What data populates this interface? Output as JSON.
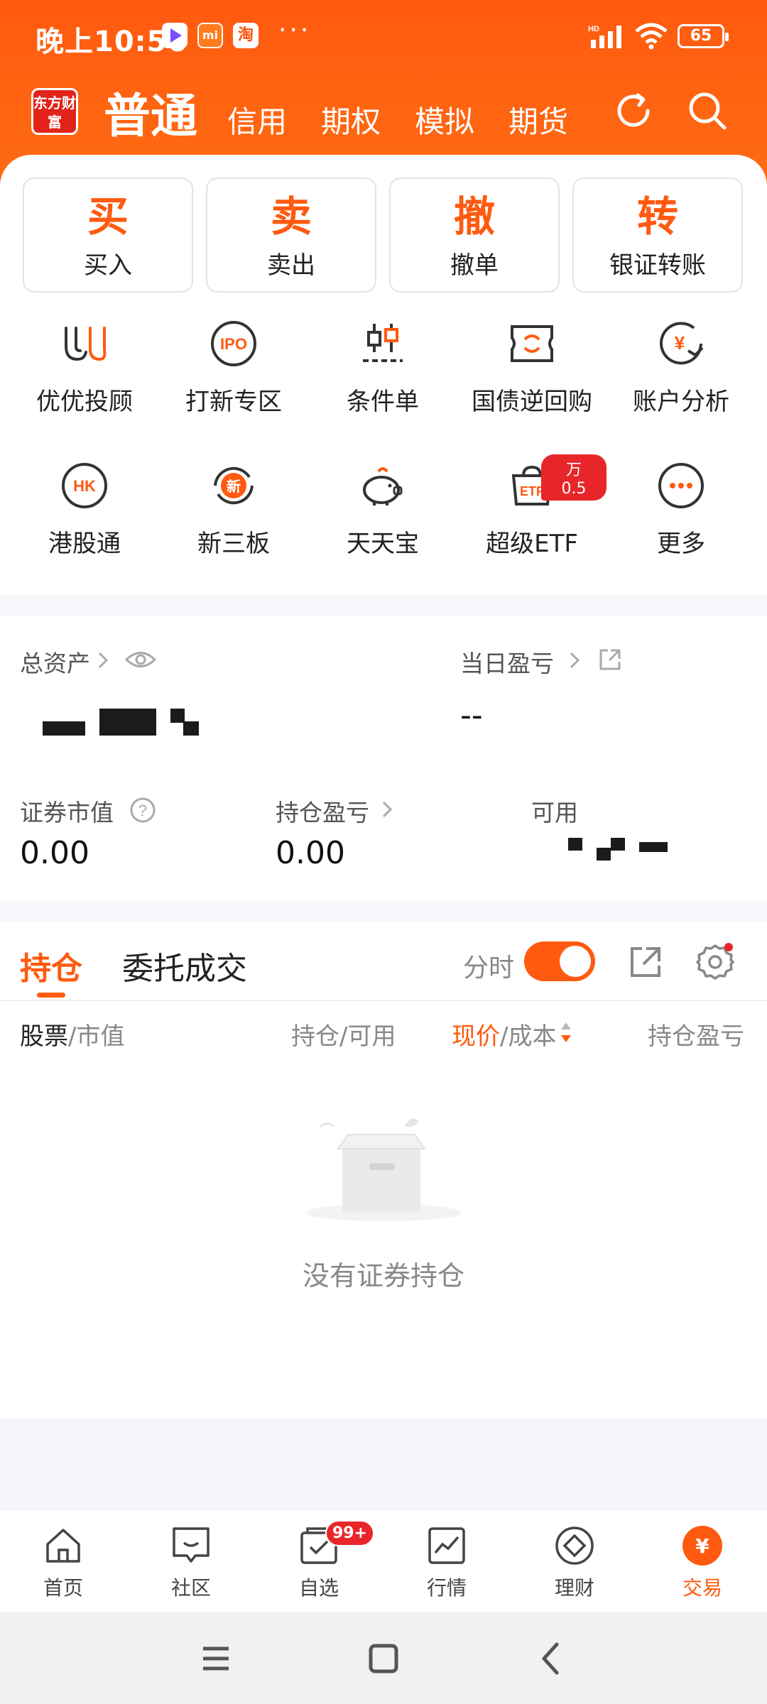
{
  "status": {
    "time": "晚上10:56",
    "more": "···",
    "battery": "65",
    "network": "HD"
  },
  "nav": {
    "logo_text": "东方财富",
    "tabs": [
      "普通",
      "信用",
      "期权",
      "模拟",
      "期货"
    ],
    "active_tab": "普通"
  },
  "actions": [
    {
      "big": "买",
      "small": "买入"
    },
    {
      "big": "卖",
      "small": "卖出"
    },
    {
      "big": "撤",
      "small": "撤单"
    },
    {
      "big": "转",
      "small": "银证转账"
    }
  ],
  "shortcuts_row1": [
    {
      "label": "优优投顾",
      "icon": "uu-advisor-icon"
    },
    {
      "label": "打新专区",
      "icon": "ipo-icon"
    },
    {
      "label": "条件单",
      "icon": "condition-order-icon"
    },
    {
      "label": "国债逆回购",
      "icon": "reverse-repo-icon"
    },
    {
      "label": "账户分析",
      "icon": "account-analysis-icon"
    }
  ],
  "shortcuts_row2": [
    {
      "label": "港股通",
      "icon": "hk-connect-icon"
    },
    {
      "label": "新三板",
      "icon": "neeq-icon"
    },
    {
      "label": "天天宝",
      "icon": "piggy-bank-icon"
    },
    {
      "label": "超级ETF",
      "icon": "etf-icon",
      "badge": "万0.5"
    },
    {
      "label": "更多",
      "icon": "more-icon"
    }
  ],
  "assets": {
    "total_label": "总资产",
    "daily_pl_label": "当日盈亏",
    "daily_pl_value": "--",
    "market_value_label": "证券市值",
    "market_value": "0.00",
    "position_pl_label": "持仓盈亏",
    "position_pl": "0.00",
    "available_label": "可用"
  },
  "positions": {
    "tab_holdings": "持仓",
    "tab_orders": "委托成交",
    "timeshare_label": "分时",
    "col_stock": "股票",
    "col_market": "/市值",
    "col_hold": "持仓/可用",
    "col_price": "现价",
    "col_cost": "/成本",
    "col_pl": "持仓盈亏",
    "empty_text": "没有证券持仓"
  },
  "bottom_nav": [
    {
      "label": "首页",
      "icon": "home-icon"
    },
    {
      "label": "社区",
      "icon": "community-icon"
    },
    {
      "label": "自选",
      "icon": "watchlist-icon",
      "badge": "99+"
    },
    {
      "label": "行情",
      "icon": "market-icon"
    },
    {
      "label": "理财",
      "icon": "wealth-icon"
    },
    {
      "label": "交易",
      "icon": "trade-icon",
      "active": true
    }
  ],
  "colors": {
    "brand": "#ff5a10",
    "badge": "#e8262a"
  }
}
